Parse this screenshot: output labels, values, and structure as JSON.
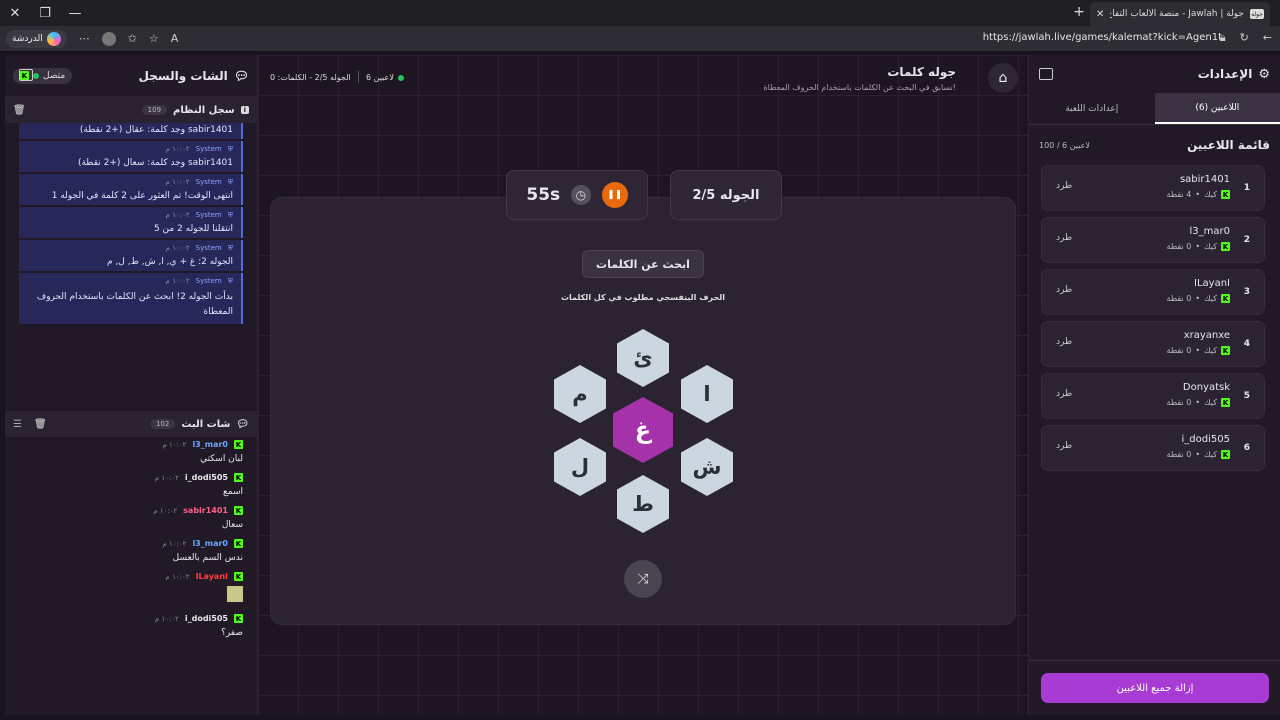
{
  "browser": {
    "tab_title": "جولة | Jawlah - منصة الألعاب التفاع",
    "tab_favicon": "جولة",
    "url": "https://jawlah.live/games/kalemat?kick=Agen1t",
    "chat_label": "الدردشة"
  },
  "chat_panel": {
    "title": "الشات والسجل",
    "status": "متصل",
    "system_log": {
      "title": "سجل النظام",
      "count": "109",
      "messages": [
        {
          "author": "",
          "time": "",
          "text": "sabir1401 وجد كلمة: عقال (+2 نقطة)"
        },
        {
          "author": "System",
          "time": "١٠:٠٢ م",
          "text": "sabir1401 وجد كلمة: سعال (+2 نقطة)"
        },
        {
          "author": "System",
          "time": "١٠:٠٢ م",
          "text": "انتهى الوقت! تم العثور على 2 كلمة في الجوله 1"
        },
        {
          "author": "System",
          "time": "١٠:٠٢ م",
          "text": "انتقلنا للجوله 2 من 5"
        },
        {
          "author": "System",
          "time": "١٠:٠٢ م",
          "text": "الجوله 2: غ + ي, ا, ش, ط, ل, م"
        },
        {
          "author": "System",
          "time": "١٠:٠٢ م",
          "text": "بدأت الجوله 2! ابحث عن الكلمات باستخدام الحروف المعطاة"
        }
      ]
    },
    "live_chat": {
      "title": "شات البث",
      "count": "102",
      "messages": [
        {
          "user": "l3_mar0",
          "color": "#6aa8ff",
          "time": "١٠:٠٢ م",
          "text": "لبان اسكتي"
        },
        {
          "user": "i_dodi505",
          "color": "#e8e8e8",
          "time": "١٠:٠٢ م",
          "text": "اسمع"
        },
        {
          "user": "sabir1401",
          "color": "#ff5f8a",
          "time": "١٠:٠٢ م",
          "text": "سعال"
        },
        {
          "user": "l3_mar0",
          "color": "#6aa8ff",
          "time": "١٠:٠٢ م",
          "text": "ندس السم بالعسل"
        },
        {
          "user": "ILayanI",
          "color": "#ff3d3d",
          "time": "١٠:٠٢ م",
          "text": ""
        },
        {
          "user": "i_dodi505",
          "color": "#e8e8e8",
          "time": "١٠:٠٢ م",
          "text": "صفر؟"
        }
      ]
    }
  },
  "game": {
    "title": "جوله كلمات",
    "subtitle": "تسابق في البحث عن الكلمات باستخدام الحروف المعطاة!",
    "players_online": "6 لاعبين",
    "round_info": "الجوله 2/5 - الكلمات: 0",
    "round_card": "الجوله 2/5",
    "timer": "55s",
    "find_button": "ابحث عن الكلمات",
    "hint": "الحرف البنفسجي مطلوب في كل الكلمات",
    "center_letter": "غ",
    "letters": {
      "top": "ئ",
      "top_right": "ا",
      "bottom_right": "ش",
      "bottom": "ط",
      "bottom_left": "ل",
      "top_left": "م"
    }
  },
  "settings_panel": {
    "title": "الإعدادات",
    "tabs": {
      "players": "اللاعبين (6)",
      "game_settings": "إعدادات اللعبة"
    },
    "list_title": "قائمة اللاعبين",
    "list_count": "100 / 6 لاعبين",
    "kick_label": "طرد",
    "platform_label": "كيك",
    "players": [
      {
        "num": "1",
        "name": "sabir1401",
        "points": "4 نقطة"
      },
      {
        "num": "2",
        "name": "l3_mar0",
        "points": "0 نقطة"
      },
      {
        "num": "3",
        "name": "ILayanI",
        "points": "0 نقطة"
      },
      {
        "num": "4",
        "name": "xrayanxe",
        "points": "0 نقطة"
      },
      {
        "num": "5",
        "name": "Donyatsk",
        "points": "0 نقطة"
      },
      {
        "num": "6",
        "name": "i_dodi505",
        "points": "0 نقطة"
      }
    ],
    "remove_all": "إزالة جميع اللاعبين"
  }
}
